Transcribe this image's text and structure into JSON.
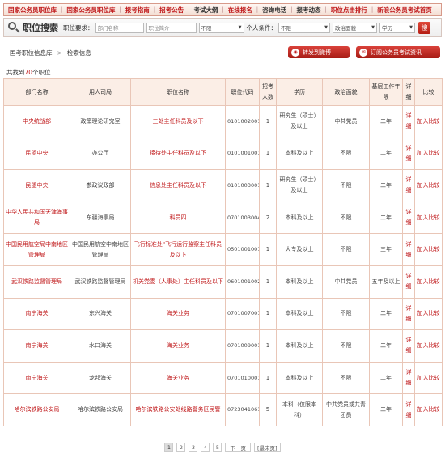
{
  "topnav": [
    "国家公务员职位库",
    "国家公务员职位库",
    "报考指南",
    "招考公告",
    "考试大纲",
    "在线报名",
    "咨询电话",
    "报考动态",
    "职位点击排行",
    "新浪公务员考试首页"
  ],
  "search": {
    "title": "职位搜索",
    "job_req_label": "职位要求：",
    "dept_placeholder": "部门名称",
    "intro_placeholder": "职位简介",
    "limit_select": "不限",
    "personal_label": "个人条件：",
    "personal_select": "不限",
    "political_select": "政治面貌",
    "edu_select": "学历",
    "go_label": "搜"
  },
  "breadcrumb": {
    "home": "国考职位信息库",
    "current": "检索信息"
  },
  "buttons": {
    "weibo": "转发到微博",
    "subscribe": "订阅公务员考试资讯"
  },
  "found": {
    "prefix": "共找到",
    "count": "70",
    "suffix": "个职位"
  },
  "table": {
    "headers": [
      "部门名称",
      "用人司局",
      "职位名称",
      "职位代码",
      "招考人数",
      "学历",
      "政治面貌",
      "基层工作年限",
      "详细",
      "比较"
    ],
    "rows": [
      {
        "dept": "中央统战部",
        "bureau": "政策理论研究室",
        "title": "三处主任科员及以下",
        "code": "0101002001",
        "num": "1",
        "edu": "研究生（硕士）及以上",
        "pol": "中共党员",
        "years": "二年",
        "detail": "详细",
        "cmp": "加入比较"
      },
      {
        "dept": "民盟中央",
        "bureau": "办公厅",
        "title": "接待处主任科员及以下",
        "code": "0101001001",
        "num": "1",
        "edu": "本科及以上",
        "pol": "不限",
        "years": "二年",
        "detail": "详细",
        "cmp": "加入比较"
      },
      {
        "dept": "民盟中央",
        "bureau": "参政议政部",
        "title": "信息处主任科员及以下",
        "code": "0101003001",
        "num": "1",
        "edu": "研究生（硕士）及以上",
        "pol": "不限",
        "years": "二年",
        "detail": "详细",
        "cmp": "加入比较"
      },
      {
        "dept": "中华人民共和国天津海事局",
        "bureau": "东疆海事局",
        "title": "科员四",
        "code": "0701003004",
        "num": "2",
        "edu": "本科及以上",
        "pol": "不限",
        "years": "二年",
        "detail": "详细",
        "cmp": "加入比较"
      },
      {
        "dept": "中国民用航空局中南地区管理局",
        "bureau": "中国民用航空中南地区管理局",
        "title": "飞行标准处\"飞行运行监察主任科员及以下",
        "code": "0501001001",
        "num": "1",
        "edu": "大专及以上",
        "pol": "不限",
        "years": "三年",
        "detail": "详细",
        "cmp": "加入比较"
      },
      {
        "dept": "武汉铁路监督管理局",
        "bureau": "武汉铁路监督管理局",
        "title": "机关党委（人事处）主任科员及以下",
        "code": "0601001002",
        "num": "1",
        "edu": "本科及以上",
        "pol": "中共党员",
        "years": "五年及以上",
        "detail": "详细",
        "cmp": "加入比较"
      },
      {
        "dept": "南宁海关",
        "bureau": "东兴海关",
        "title": "海关业务",
        "code": "0701007001",
        "num": "1",
        "edu": "本科及以上",
        "pol": "不限",
        "years": "二年",
        "detail": "详细",
        "cmp": "加入比较"
      },
      {
        "dept": "南宁海关",
        "bureau": "水口海关",
        "title": "海关业务",
        "code": "0701009001",
        "num": "1",
        "edu": "本科及以上",
        "pol": "不限",
        "years": "二年",
        "detail": "详细",
        "cmp": "加入比较"
      },
      {
        "dept": "南宁海关",
        "bureau": "龙邦海关",
        "title": "海关业务",
        "code": "0701010001",
        "num": "1",
        "edu": "本科及以上",
        "pol": "不限",
        "years": "二年",
        "detail": "详细",
        "cmp": "加入比较"
      },
      {
        "dept": "哈尔滨铁路公安局",
        "bureau": "哈尔滨铁路公安局",
        "title": "哈尔滨铁路公安处线路警务区民警",
        "code": "0723041061",
        "num": "5",
        "edu": "本科（仅限本科）",
        "pol": "中共党员或共青团员",
        "years": "二年",
        "detail": "详细",
        "cmp": "加入比较"
      }
    ]
  },
  "pagination": {
    "pages": [
      "1",
      "2",
      "3",
      "4",
      "5"
    ],
    "current": "1",
    "next": "下一页",
    "last": "[最末页]"
  }
}
